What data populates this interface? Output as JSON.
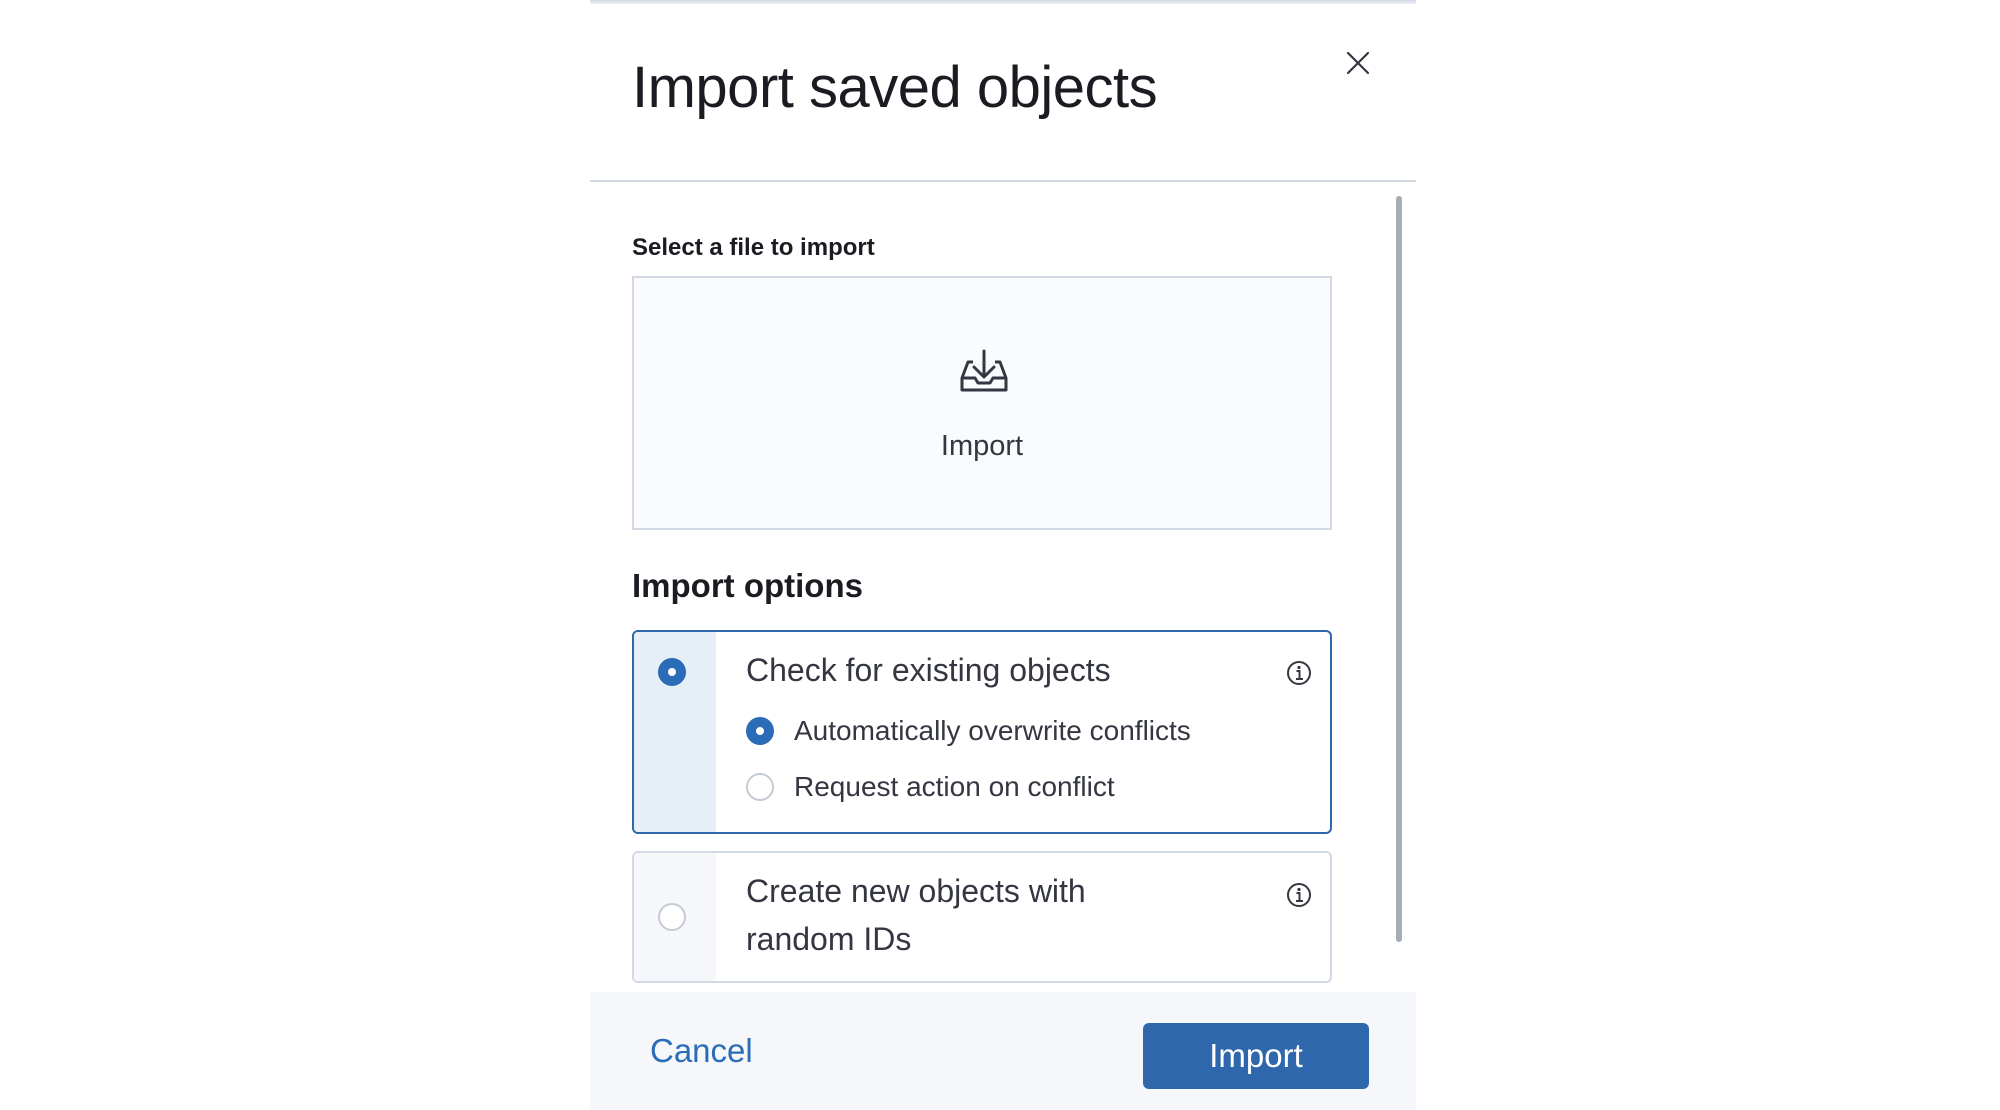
{
  "flyout": {
    "title": "Import saved objects",
    "close_icon": "close-icon"
  },
  "file_picker": {
    "label": "Select a file to import",
    "prompt": "Import",
    "icon": "import-tray-icon"
  },
  "import_options": {
    "heading": "Import options",
    "options": [
      {
        "label": "Check for existing objects",
        "selected": true,
        "info_icon": "info-icon",
        "sub_options": [
          {
            "label": "Automatically overwrite conflicts",
            "selected": true
          },
          {
            "label": "Request action on conflict",
            "selected": false
          }
        ]
      },
      {
        "label": "Create new objects with random IDs",
        "selected": false,
        "info_icon": "info-icon"
      }
    ]
  },
  "footer": {
    "cancel_label": "Cancel",
    "import_label": "Import"
  },
  "colors": {
    "accent": "#2f67ad",
    "link": "#2b6cb8",
    "border": "#d3dae6",
    "footer_bg": "#f5f7fa"
  }
}
